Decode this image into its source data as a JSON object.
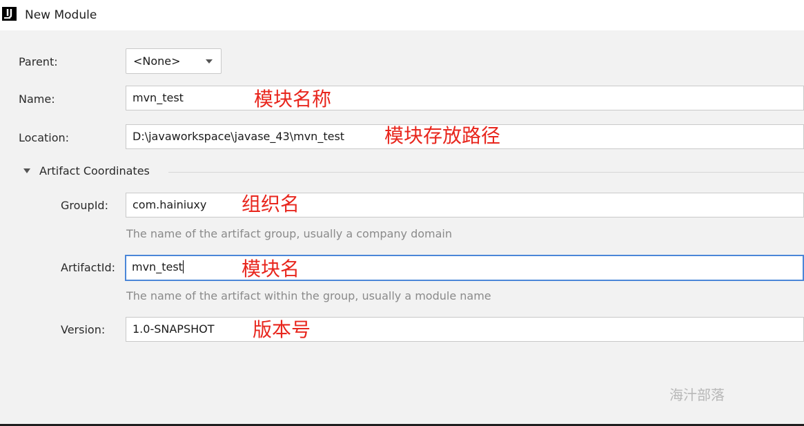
{
  "window": {
    "title": "New Module",
    "app_icon_text": "IJ"
  },
  "form": {
    "parent": {
      "label": "Parent:",
      "value": "<None>"
    },
    "name": {
      "label": "Name:",
      "value": "mvn_test"
    },
    "location": {
      "label": "Location:",
      "value": "D:\\javaworkspace\\javase_43\\mvn_test"
    },
    "section": {
      "title": "Artifact Coordinates"
    },
    "group_id": {
      "label": "GroupId:",
      "value": "com.hainiuxy",
      "hint": "The name of the artifact group, usually a company domain"
    },
    "artifact_id": {
      "label": "ArtifactId:",
      "value": "mvn_test",
      "hint": "The name of the artifact within the group, usually a module name"
    },
    "version": {
      "label": "Version:",
      "value": "1.0-SNAPSHOT"
    }
  },
  "annotations": {
    "name": "模块名称",
    "location": "模块存放路径",
    "group_id": "组织名",
    "artifact_id": "模块名",
    "version": "版本号"
  },
  "watermark": "海汁部落",
  "colors": {
    "annotation": "#e8261d",
    "focus_border": "#4a86d8",
    "background": "#f2f2f2"
  }
}
